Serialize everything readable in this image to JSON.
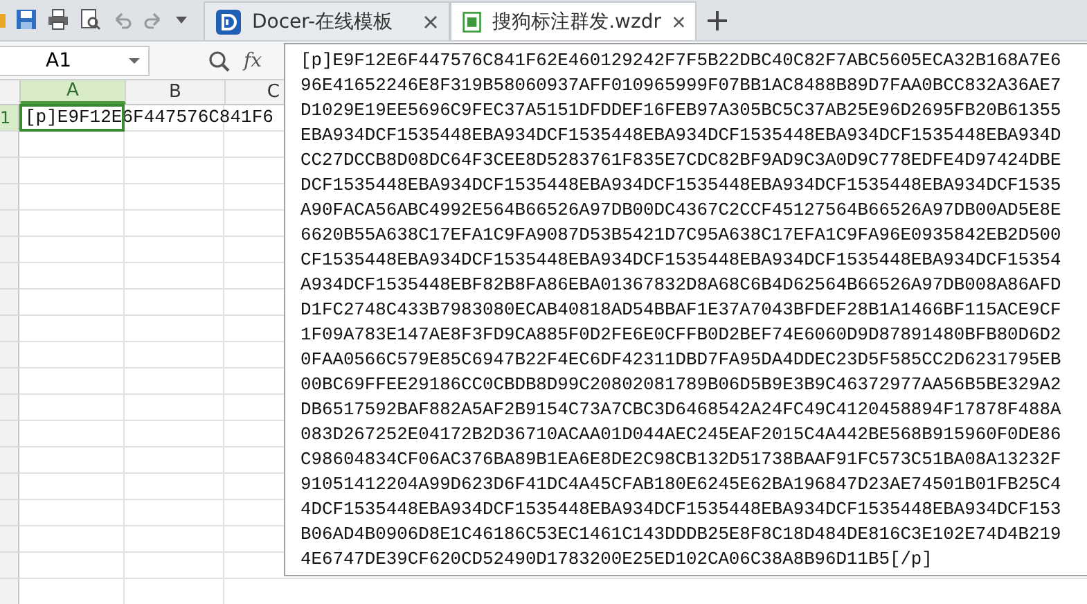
{
  "tabs": [
    {
      "label": "Docer-在线模板",
      "selected": false,
      "kind": "docer"
    },
    {
      "label": "搜狗标注群发.wzdr",
      "selected": true,
      "kind": "sheet"
    }
  ],
  "name_box": {
    "value": "A1"
  },
  "fx_label": "fx",
  "grid": {
    "columns": [
      {
        "label": "A",
        "selected": true
      },
      {
        "label": "B",
        "selected": false
      },
      {
        "label": "C",
        "selected": false
      }
    ],
    "rows": [
      {
        "label": "1",
        "selected": true
      }
    ],
    "cell_text": "[p]E9F12E6F447576C841F6"
  },
  "formula_popup": {
    "lines": [
      "[p]E9F12E6F447576C841F62E460129242F7F5B22DBC40C82F7ABC5605ECA32B168A7E6",
      "96E41652246E8F319B58060937AFF010965999F07BB1AC8488B89D7FAA0BCC832A36AE7",
      "D1029E19EE5696C9FEC37A5151DFDDEF16FEB97A305BC5C37AB25E96D2695FB20B61355",
      "EBA934DCF1535448EBA934DCF1535448EBA934DCF1535448EBA934DCF1535448EBA934D",
      "CC27DCCB8D08DC64F3CEE8D5283761F835E7CDC82BF9AD9C3A0D9C778EDFE4D97424DBE",
      "DCF1535448EBA934DCF1535448EBA934DCF1535448EBA934DCF1535448EBA934DCF1535",
      "A90FACA56ABC4992E564B66526A97DB00DC4367C2CCF45127564B66526A97DB00AD5E8E",
      "6620B55A638C17EFA1C9FA9087D53B5421D7C95A638C17EFA1C9FA96E0935842EB2D500",
      "CF1535448EBA934DCF1535448EBA934DCF1535448EBA934DCF1535448EBA934DCF15354",
      "A934DCF1535448EBF82B8FA86EBA01367832D8A68C6B4D62564B66526A97DB008A86AFD",
      "D1FC2748C433B7983080ECAB40818AD54BBAF1E37A7043BFDEF28B1A1466BF115ACE9CF",
      "1F09A783E147AE8F3FD9CA885F0D2FE6E0CFFB0D2BEF74E6060D9D87891480BFB80D6D2",
      "0FAA0566C579E85C6947B22F4EC6DF42311DBD7FA95DA4DDEC23D5F585CC2D6231795EB",
      "00BC69FFEE29186CC0CBDB8D99C20802081789B06D5B9E3B9C46372977AA56B5BE329A2",
      "DB6517592BAF882A5AF2B9154C73A7CBC3D6468542A24FC49C4120458894F17878F488A",
      "083D267252E04172B2D36710ACAA01D044AEC245EAF2015C4A442BE568B915960F0DE86",
      "C98604834CF06AC376BA89B1EA6E8DE2C98CB132D51738BAAF91FC573C51BA08A13232F",
      "91051412204A99D623D6F41DC4A45CFAB180E6245E62BA196847D23AE74501B01FB25C4",
      "4DCF1535448EBA934DCF1535448EBA934DCF1535448EBA934DCF1535448EBA934DCF153",
      "B06AD4B0906D8E1C46186C53EC1461C143DDDB25E8F8C18D484DE816C3E102E74D4B219",
      "4E6747DE39CF620CD52490D1783200E25ED102CA06C38A8B96D11B5[/p]"
    ]
  }
}
